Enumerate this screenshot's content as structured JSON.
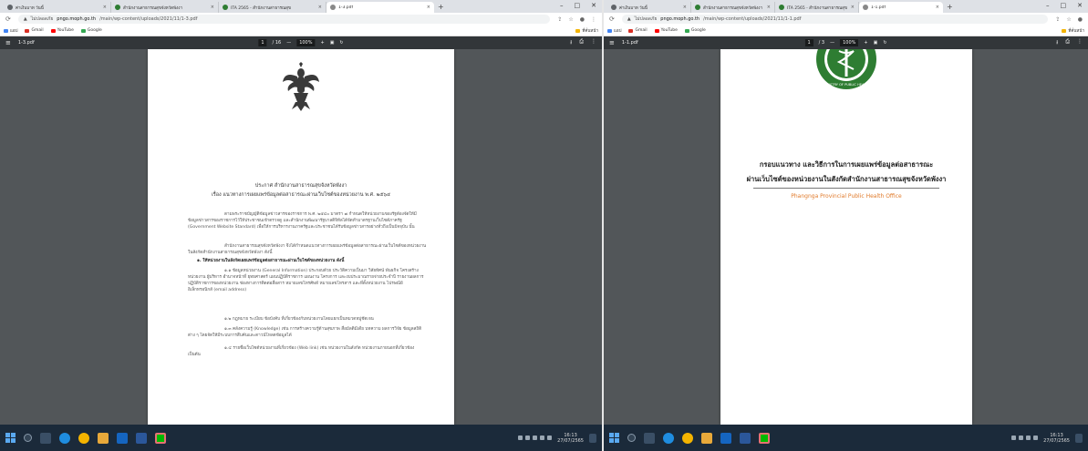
{
  "left": {
    "tabs": [
      {
        "label": "ค่าเงินบาท วันนี้",
        "favicon": "globe"
      },
      {
        "label": "สำนักงานสาธารณสุขจังหวัดพังงา",
        "favicon": "moph"
      },
      {
        "label": "ITA 2565 - สำนักงานสาธารณสุข",
        "favicon": "moph"
      },
      {
        "label": "1-3.pdf",
        "favicon": "pdf"
      }
    ],
    "address": {
      "secure_label": "ไม่ปลอดภัย",
      "host": "pngo.moph.go.th",
      "path": "/main/wp-content/uploads/2021/11/1-3.pdf"
    },
    "bookmarks": [
      "แอป",
      "Gmail",
      "YouTube",
      "Google"
    ],
    "bookmarks_right": "ที่คั่นหน้า",
    "pdf": {
      "filename": "1-3.pdf",
      "page": "1",
      "total": "/ 16",
      "zoom": "100%"
    },
    "doc": {
      "title_line1": "ประกาศ สำนักงานสาธารณสุขจังหวัดพังงา",
      "title_line2": "เรื่อง แนวทางการเผยแพร่ข้อมูลต่อสาธารณะผ่านเว็บไซต์ของหน่วยงาน พ.ศ. ๒๕๖๔",
      "paragraphs": [
        {
          "text": "ตามพระราชบัญญัติข้อมูลข่าวสารของราชการ พ.ศ. ๒๕๔๐ มาตรา ๗ กำหนดให้หน่วยงานของรัฐต้องจัดให้มีข้อมูลข่าวสารของราชการไว้ให้ประชาชนเข้าตรวจดู และสำนักงานพัฒนารัฐบาลดิจิทัลได้จัดทำมาตรฐานเว็บไซต์ภาครัฐ (Government Website Standard) เพื่อให้การบริหารงานภาครัฐและประชาชนได้รับข้อมูลข่าวสารอย่างทั่วถึงเป็นปัจจุบัน นั้น",
          "bold": false
        },
        {
          "text": "สำนักงานสาธารณสุขจังหวัดพังงา จึงได้กำหนดแนวทางการเผยแพร่ข้อมูลต่อสาธารณะผ่านเว็บไซต์ของหน่วยงานในสังกัดสำนักงานสาธารณสุขจังหวัดพังงา ดังนี้",
          "bold": false
        },
        {
          "text": "๑. ให้หน่วยงานในสังกัดเผยแพร่ข้อมูลต่อสาธารณะผ่านเว็บไซต์ของหน่วยงาน ดังนี้",
          "bold": true
        },
        {
          "text": "๑.๑ ข้อมูลหน่วยงาน (General Information) ประกอบด้วย ประวัติความเป็นมา วิสัยทัศน์ พันธกิจ โครงสร้างหน่วยงาน ผู้บริหาร อำนาจหน้าที่ ยุทธศาสตร์ แผนปฏิบัติราชการ แผนงาน โครงการ และงบประมาณรายจ่ายประจำปี รายงานผลการปฏิบัติราชการของหน่วยงาน ช่องทางการติดต่อสื่อสาร หมายเลขโทรศัพท์ หมายเลขโทรสาร และที่ตั้งหน่วยงาน ไปรษณีย์อิเล็กทรอนิกส์ (email address)",
          "bold": false
        },
        {
          "text": "๑.๒ กฎหมาย ระเบียบ ข้อบังคับ ที่เกี่ยวข้องกับหน่วยงานโดยแยกเป็นหมวดหมู่ชัดเจน",
          "bold": false
        },
        {
          "text": "๑.๓ คลังความรู้ (Knowledge) เช่น การสร้างความรู้ด้านสุขภาพ สื่อมัลติมีเดีย บทความ ผลการวิจัย ข้อมูลสถิติต่าง ๆ โดยจัดให้มีระบบการสืบค้นและดาวน์โหลดข้อมูลได้",
          "bold": false
        },
        {
          "text": "๑.๔ รายชื่อเว็บไซต์หน่วยงานที่เกี่ยวข้อง (Web link) เช่น หน่วยงานในสังกัด หน่วยงานภายนอกที่เกี่ยวข้อง เป็นต้น",
          "bold": false
        }
      ]
    }
  },
  "right": {
    "tabs": [
      {
        "label": "ค่าเงินบาท วันนี้",
        "favicon": "globe"
      },
      {
        "label": "สำนักงานสาธารณสุขจังหวัดพังงา",
        "favicon": "moph"
      },
      {
        "label": "ITA 2565 - สำนักงานสาธารณสุข",
        "favicon": "moph"
      },
      {
        "label": "1-1.pdf",
        "favicon": "pdf"
      }
    ],
    "address": {
      "secure_label": "ไม่ปลอดภัย",
      "host": "pngo.moph.go.th",
      "path": "/main/wp-content/uploads/2021/11/1-1.pdf"
    },
    "bookmarks": [
      "แอป",
      "Gmail",
      "YouTube",
      "Google"
    ],
    "bookmarks_right": "ที่คั่นหน้า",
    "pdf": {
      "filename": "1-1.pdf",
      "page": "1",
      "total": "/ 3",
      "zoom": "100%"
    },
    "doc": {
      "title_line1": "กรอบแนวทาง และวิธีการในการเผยแพร่ข้อมูลต่อสาธารณะ",
      "title_line2": "ผ่านเว็บไซต์ของหน่วยงานในสังกัดสำนักงานสาธารณสุขจังหวัดพังงา",
      "subtitle": "Phangnga Provincial Public Health Office",
      "emblem_text": "MINISTRY OF PUBLIC HEALTH"
    }
  },
  "colors": {
    "tab_strip": "#dee1e6",
    "pdf_toolbar": "#323639",
    "pdf_bg": "#525659",
    "taskbar": "#1b2a3a",
    "accent_orange": "#e07a2a",
    "moph_green": "#2e7d32"
  },
  "taskbar": {
    "icons": [
      "windows-start",
      "search",
      "task-view",
      "edge",
      "chrome",
      "file-explorer",
      "mail",
      "word",
      "line"
    ],
    "time": "16:13",
    "date": "27/07/2565"
  }
}
